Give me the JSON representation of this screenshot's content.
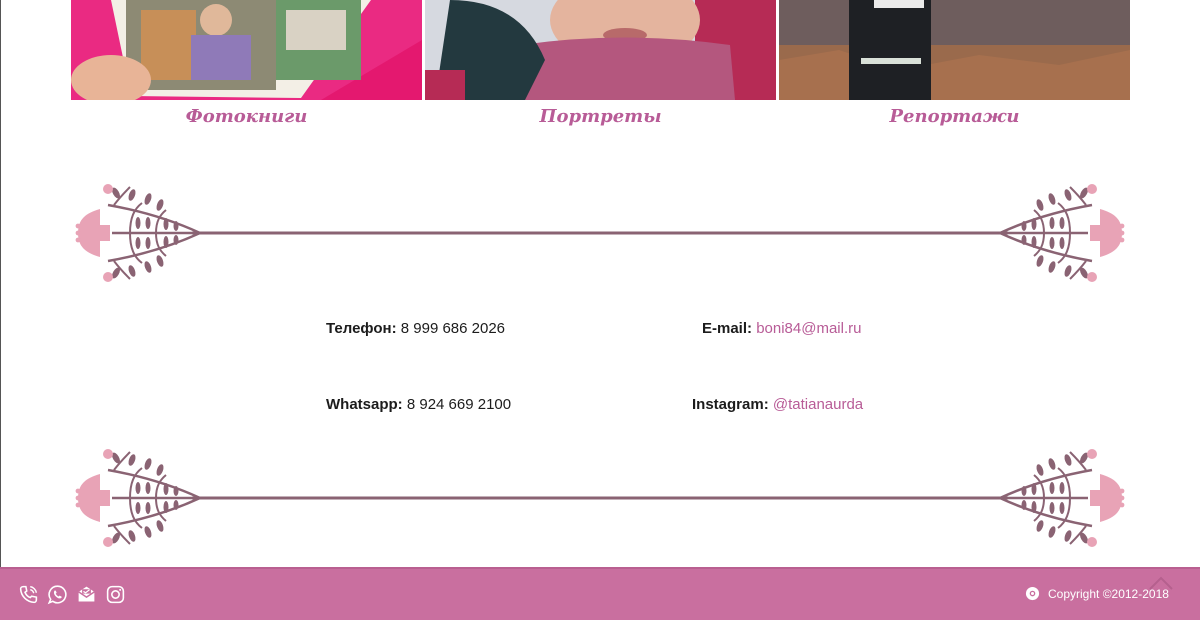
{
  "gallery": {
    "items": [
      {
        "caption": "Фотокниги",
        "image": "photobook-photo"
      },
      {
        "caption": "Портреты",
        "image": "portrait-photo"
      },
      {
        "caption": "Репортажи",
        "image": "reportage-photo"
      }
    ]
  },
  "contacts": {
    "phone": {
      "label": "Телефон:",
      "value": "8 999 686 2026"
    },
    "whatsapp": {
      "label": "Whatsapp:",
      "value": "8 924 669 2100"
    },
    "email": {
      "label": "E-mail:",
      "value": "boni84@mail.ru"
    },
    "instagram": {
      "label": "Instagram:",
      "value": "@tatianaurda"
    }
  },
  "footer": {
    "icons": [
      "phone-icon",
      "whatsapp-icon",
      "mail-icon",
      "instagram-icon"
    ],
    "copyright": "Copyright ©2012-2018"
  },
  "colors": {
    "accent": "#b85c97",
    "footer": "#c96f9f",
    "ornament_line": "#8a6373",
    "ornament_pink": "#e8a3b6"
  }
}
